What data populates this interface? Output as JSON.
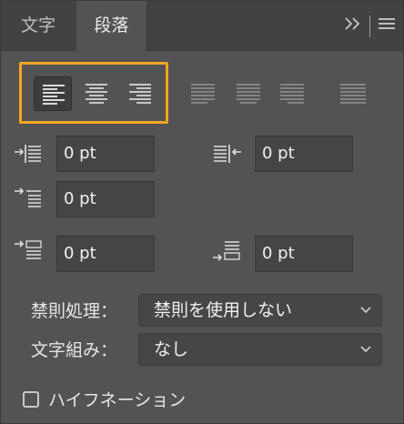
{
  "tabs": [
    {
      "label": "文字"
    },
    {
      "label": "段落"
    }
  ],
  "tab_bar_icons": [
    "expand-double-chevron-icon",
    "panel-menu-icon"
  ],
  "alignment": {
    "active": "align-left",
    "buttons": [
      "align-left",
      "align-center",
      "align-right",
      "justify-last-left",
      "justify-last-center",
      "justify-last-right",
      "justify-all"
    ]
  },
  "indents": {
    "left_indent": "0 pt",
    "right_indent": "0 pt",
    "first_line_indent": "0 pt",
    "space_before": "0 pt",
    "space_after": "0 pt"
  },
  "kinsoku": {
    "label": "禁則処理：",
    "value": "禁則を使用しない"
  },
  "mojikumi": {
    "label": "文字組み：",
    "value": "なし"
  },
  "hyphenation": {
    "label": "ハイフネーション",
    "checked": false
  },
  "colors": {
    "highlight": "#f5a623",
    "panel_bg": "#535353",
    "field_bg": "#454545"
  }
}
